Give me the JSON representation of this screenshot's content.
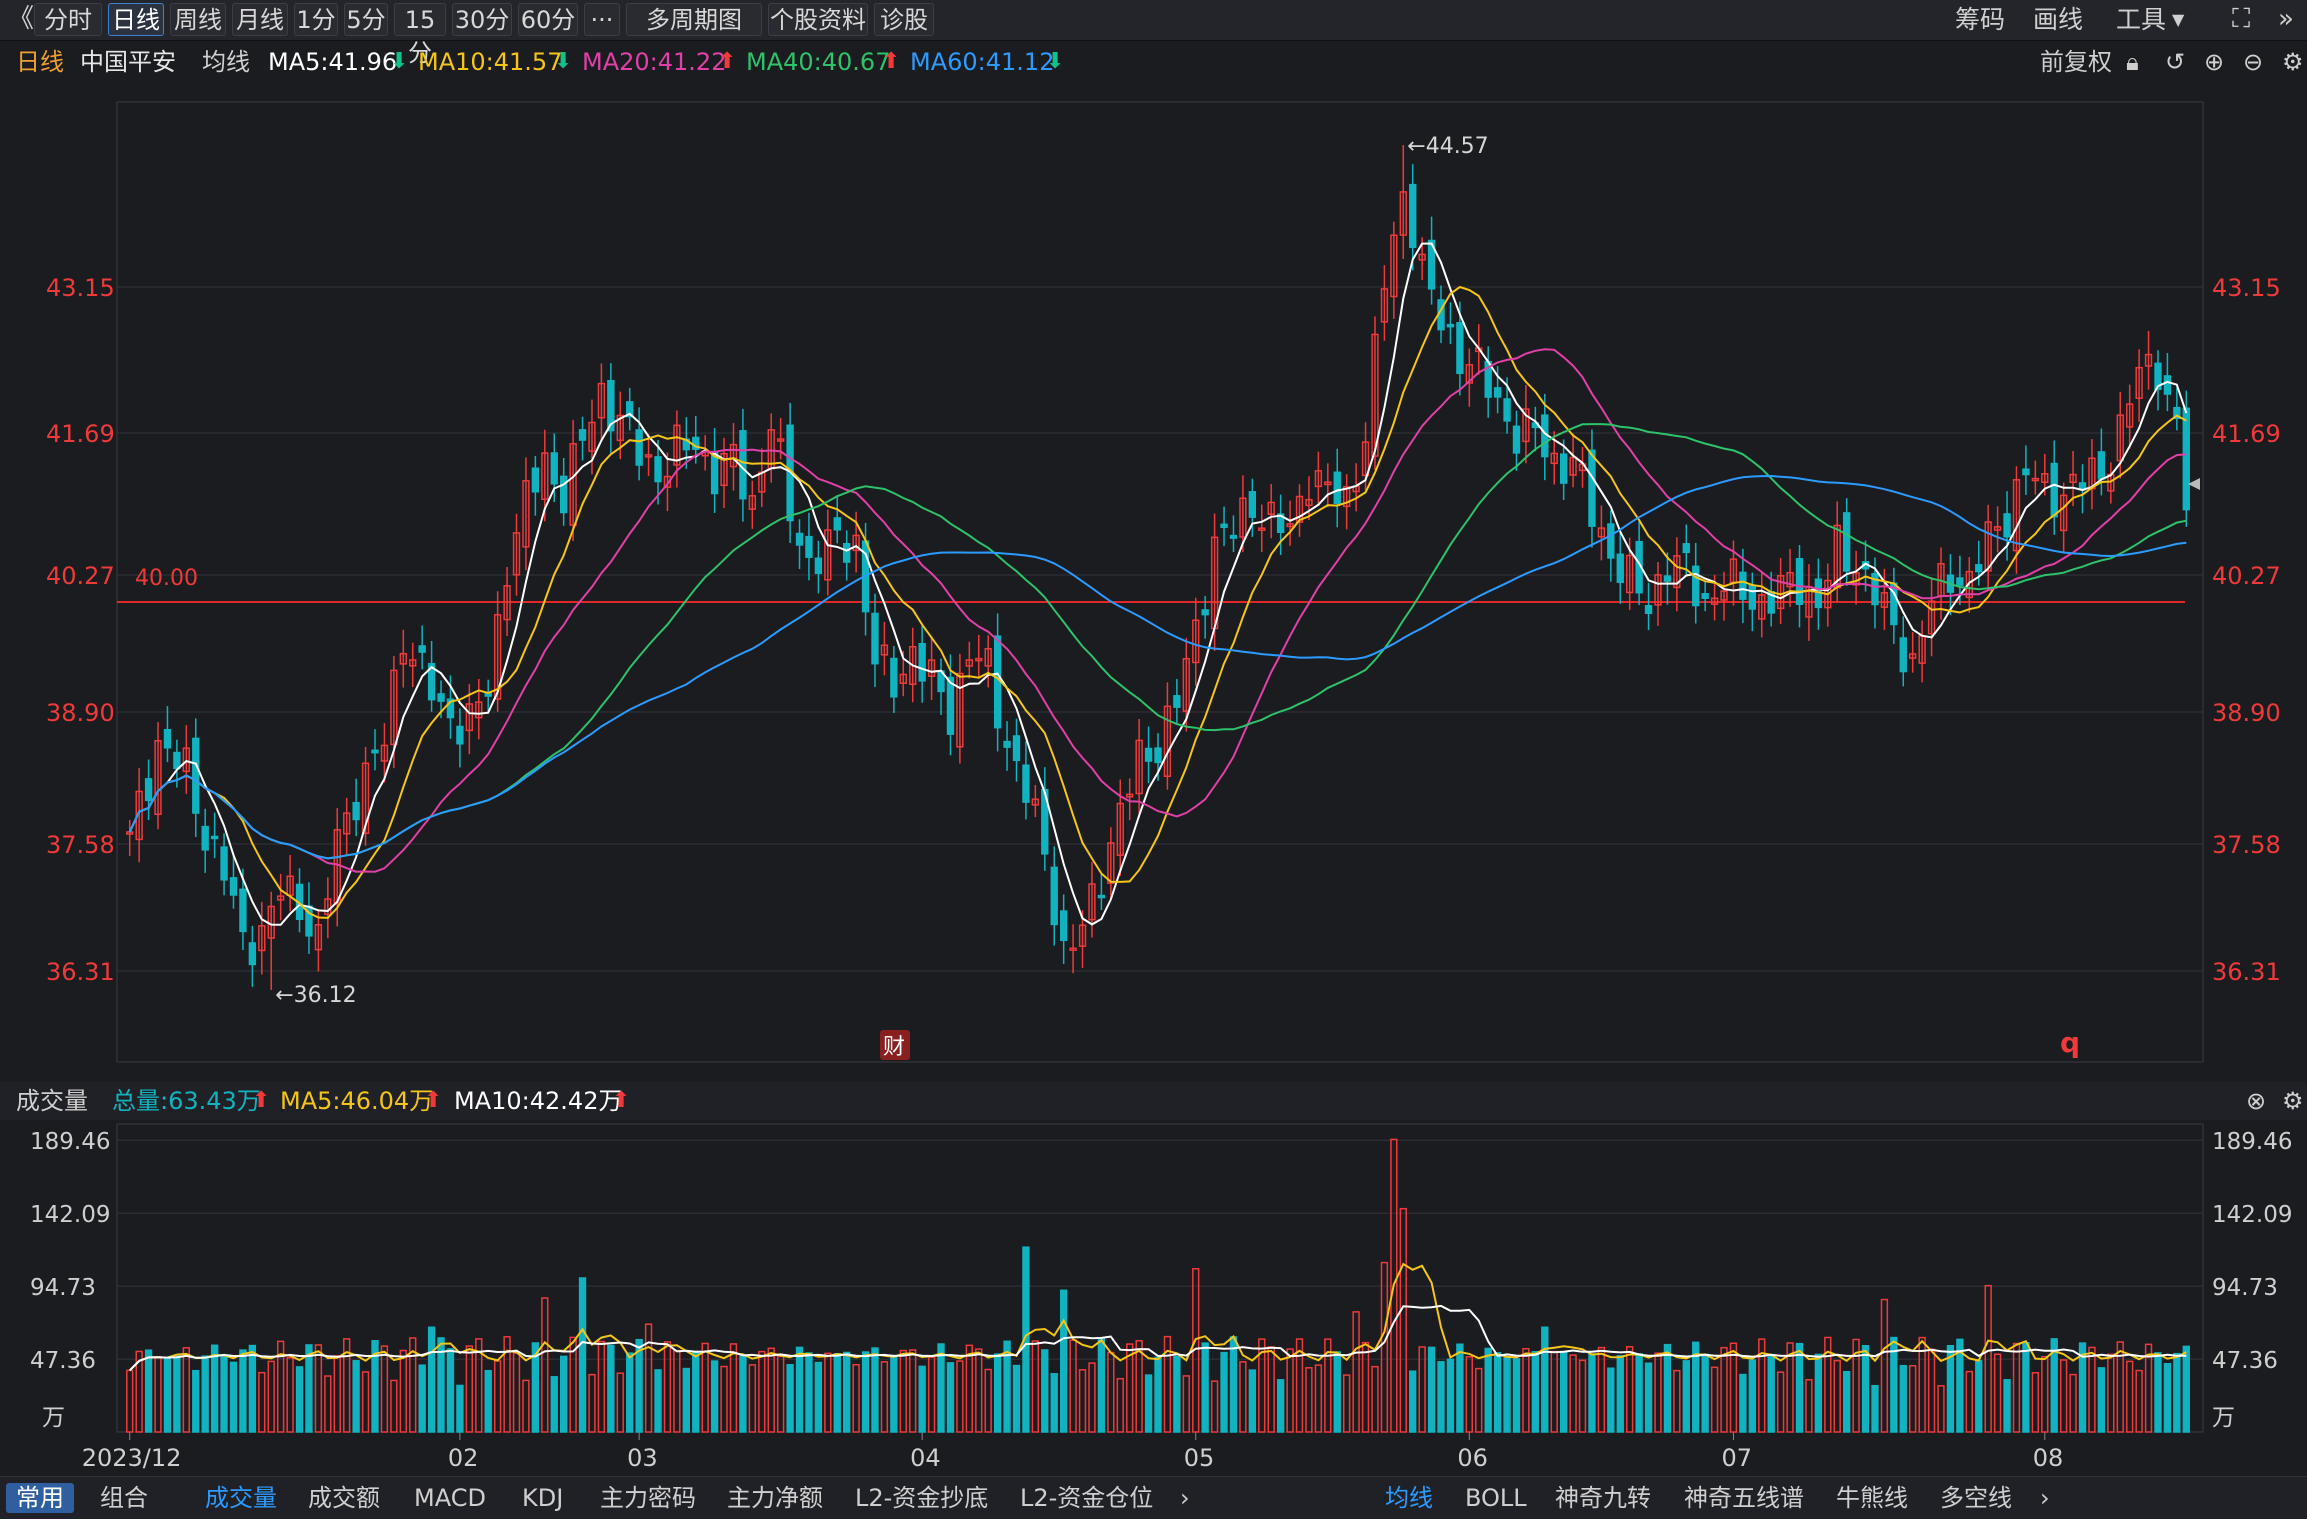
{
  "toolbar": {
    "collapse_icon": "double-chevron-left-icon",
    "tabs": [
      "分时",
      "日线",
      "周线",
      "月线",
      "1分",
      "5分",
      "15分",
      "30分",
      "60分",
      "···",
      "多周期图",
      "个股资料",
      "诊股"
    ],
    "active_tab": "日线",
    "right_items": [
      "筹码",
      "画线",
      "工具"
    ]
  },
  "ma_bar": {
    "period": "日线",
    "stock": "中国平安",
    "ma_type": "均线",
    "ma5": "MA5:41.96",
    "ma10": "MA10:41.57",
    "ma20": "MA20:41.22",
    "ma40": "MA40:40.67",
    "ma60": "MA60:41.12",
    "adjust": "前复权"
  },
  "volume_bar": {
    "title": "成交量",
    "total": "总量:63.43万",
    "ma5": "MA5:46.04万",
    "ma10": "MA10:42.42万"
  },
  "bottom_bar": {
    "left_tabs": [
      "常用",
      "组合"
    ],
    "indicators": [
      "成交量",
      "成交额",
      "MACD",
      "KDJ",
      "主力密码",
      "主力净额",
      "L2-资金抄底",
      "L2-资金仓位"
    ],
    "right_indicators": [
      "均线",
      "BOLL",
      "神奇九转",
      "神奇五线谱",
      "牛熊线",
      "多空线"
    ]
  },
  "chart_data": {
    "type": "candlestick",
    "price_axis_ticks": [
      "43.15",
      "41.69",
      "40.27",
      "38.90",
      "37.58",
      "36.31"
    ],
    "ylim": [
      35.4,
      45.0
    ],
    "reference_line": {
      "value": 40.0,
      "label": "40.00"
    },
    "annotations": {
      "high": "←44.57",
      "low": "←36.12",
      "fin_marker": "财",
      "q_marker": "q"
    },
    "volume_axis_ticks": [
      "189.46",
      "142.09",
      "94.73",
      "47.36"
    ],
    "volume_unit": "万",
    "x_ticks": [
      {
        "label": "2023/12",
        "idx": 0
      },
      {
        "label": "02",
        "idx": 35
      },
      {
        "label": "03",
        "idx": 54
      },
      {
        "label": "04",
        "idx": 84
      },
      {
        "label": "05",
        "idx": 113
      },
      {
        "label": "06",
        "idx": 142
      },
      {
        "label": "07",
        "idx": 170
      },
      {
        "label": "08",
        "idx": 203
      }
    ],
    "colors": {
      "up": "#f03a3a",
      "down": "#12b3c0",
      "ma5": "#ffffff",
      "ma10": "#f5c518",
      "ma20": "#e040a8",
      "ma40": "#2ec26a",
      "ma60": "#2c9bff",
      "grid": "#33353b"
    },
    "series_close_anchors": [
      [
        0,
        37.6
      ],
      [
        3,
        38.6
      ],
      [
        6,
        38.3
      ],
      [
        8,
        37.7
      ],
      [
        10,
        37.3
      ],
      [
        12,
        36.6
      ],
      [
        14,
        36.7
      ],
      [
        16,
        37.1
      ],
      [
        18,
        37.0
      ],
      [
        20,
        36.6
      ],
      [
        22,
        37.6
      ],
      [
        24,
        38.1
      ],
      [
        27,
        38.6
      ],
      [
        29,
        39.7
      ],
      [
        31,
        39.3
      ],
      [
        33,
        38.9
      ],
      [
        36,
        38.8
      ],
      [
        38,
        39.1
      ],
      [
        40,
        40.4
      ],
      [
        42,
        41.0
      ],
      [
        44,
        41.4
      ],
      [
        46,
        41.1
      ],
      [
        48,
        41.6
      ],
      [
        50,
        42.1
      ],
      [
        52,
        41.8
      ],
      [
        54,
        41.5
      ],
      [
        56,
        41.3
      ],
      [
        58,
        41.5
      ],
      [
        60,
        41.6
      ],
      [
        62,
        41.3
      ],
      [
        64,
        41.4
      ],
      [
        66,
        41.0
      ],
      [
        68,
        41.8
      ],
      [
        70,
        40.9
      ],
      [
        72,
        40.4
      ],
      [
        75,
        40.6
      ],
      [
        77,
        40.6
      ],
      [
        79,
        39.4
      ],
      [
        81,
        39.2
      ],
      [
        83,
        39.5
      ],
      [
        85,
        39.2
      ],
      [
        87,
        38.9
      ],
      [
        89,
        39.5
      ],
      [
        91,
        39.3
      ],
      [
        93,
        38.6
      ],
      [
        95,
        38.1
      ],
      [
        97,
        37.5
      ],
      [
        99,
        36.5
      ],
      [
        101,
        36.7
      ],
      [
        103,
        37.3
      ],
      [
        105,
        37.9
      ],
      [
        107,
        38.4
      ],
      [
        109,
        38.6
      ],
      [
        111,
        39.0
      ],
      [
        113,
        39.7
      ],
      [
        115,
        40.6
      ],
      [
        117,
        40.7
      ],
      [
        119,
        41.0
      ],
      [
        121,
        40.8
      ],
      [
        123,
        40.7
      ],
      [
        125,
        41.3
      ],
      [
        127,
        41.1
      ],
      [
        129,
        41.0
      ],
      [
        131,
        41.7
      ],
      [
        133,
        43.2
      ],
      [
        134,
        43.6
      ],
      [
        135,
        44.1
      ],
      [
        136,
        43.8
      ],
      [
        137,
        43.3
      ],
      [
        139,
        42.8
      ],
      [
        141,
        42.5
      ],
      [
        143,
        42.3
      ],
      [
        145,
        42.0
      ],
      [
        147,
        41.7
      ],
      [
        149,
        41.7
      ],
      [
        151,
        41.4
      ],
      [
        153,
        41.4
      ],
      [
        155,
        40.9
      ],
      [
        157,
        40.5
      ],
      [
        159,
        40.2
      ],
      [
        161,
        40.0
      ],
      [
        163,
        40.4
      ],
      [
        165,
        40.3
      ],
      [
        167,
        40.0
      ],
      [
        169,
        40.2
      ],
      [
        171,
        40.1
      ],
      [
        173,
        40.0
      ],
      [
        175,
        40.1
      ],
      [
        177,
        40.2
      ],
      [
        179,
        40.0
      ],
      [
        181,
        40.5
      ],
      [
        183,
        40.4
      ],
      [
        185,
        40.1
      ],
      [
        187,
        39.7
      ],
      [
        189,
        39.4
      ],
      [
        191,
        40.0
      ],
      [
        193,
        40.3
      ],
      [
        195,
        40.2
      ],
      [
        197,
        40.6
      ],
      [
        199,
        40.9
      ],
      [
        201,
        41.3
      ],
      [
        203,
        41.1
      ],
      [
        205,
        41.1
      ],
      [
        207,
        41.2
      ],
      [
        209,
        41.3
      ],
      [
        211,
        41.7
      ],
      [
        213,
        42.3
      ],
      [
        215,
        42.4
      ],
      [
        217,
        41.7
      ],
      [
        218,
        41.0
      ]
    ]
  }
}
